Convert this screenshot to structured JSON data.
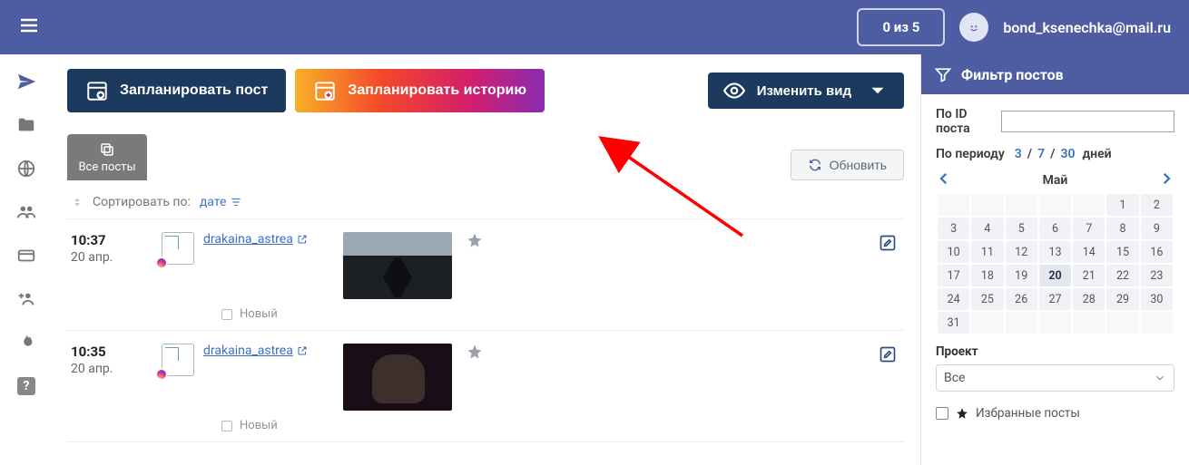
{
  "topbar": {
    "count_pill": "0 из 5",
    "username": "bond_ksenechka@mail.ru"
  },
  "main": {
    "btn_plan_post": "Запланировать пост",
    "btn_plan_story": "Запланировать историю",
    "btn_change_view": "Изменить вид",
    "tab_all_posts": "Все посты",
    "refresh": "Обновить"
  },
  "sort": {
    "label": "Сортировать по:",
    "value": "дате"
  },
  "posts": [
    {
      "time": "10:37",
      "date": "20 апр.",
      "account": "drakaina_astrea",
      "status": "Новый"
    },
    {
      "time": "10:35",
      "date": "20 апр.",
      "account": "drakaina_astrea",
      "status": "Новый"
    }
  ],
  "filter": {
    "title": "Фильтр постов",
    "by_id_label": "По ID поста",
    "by_period_label": "По периоду",
    "period_options": [
      "3",
      "7",
      "30"
    ],
    "period_tail": "дней",
    "calendar": {
      "month_name": "Май",
      "today": 20,
      "lead_empty": 5,
      "days_in_month": 31
    },
    "project_label": "Проект",
    "project_value": "Все",
    "favorites_label": "Избранные посты"
  }
}
